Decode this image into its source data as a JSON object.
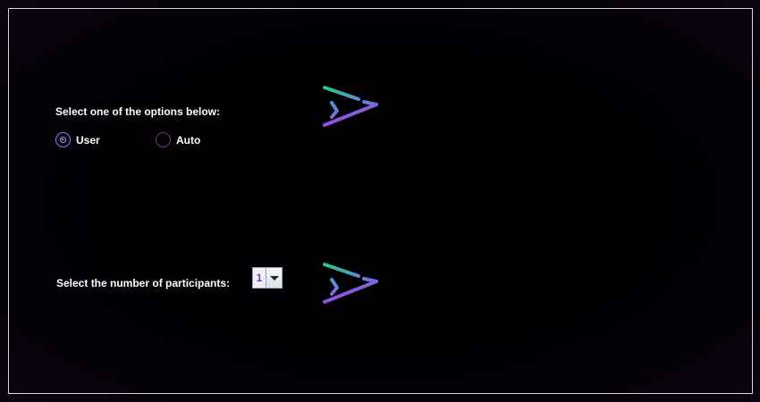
{
  "mode_section": {
    "prompt": "Select one of the options below:",
    "options": [
      {
        "label": "User",
        "selected": true
      },
      {
        "label": "Auto",
        "selected": false
      }
    ]
  },
  "participants_section": {
    "prompt": "Select the number of participants:",
    "selected_value": "1"
  },
  "next_icon": "next-arrow-icon",
  "colors": {
    "background": "#000000",
    "frame_border": "#d8d4dc",
    "text": "#ffffff",
    "radio_selected": "#8e78e6",
    "arrow_gradient_top": "#22c98a",
    "arrow_gradient_mid": "#5a8ed0",
    "arrow_gradient_bottom": "#a43ae6",
    "combo_value": "#7a3ab8"
  }
}
